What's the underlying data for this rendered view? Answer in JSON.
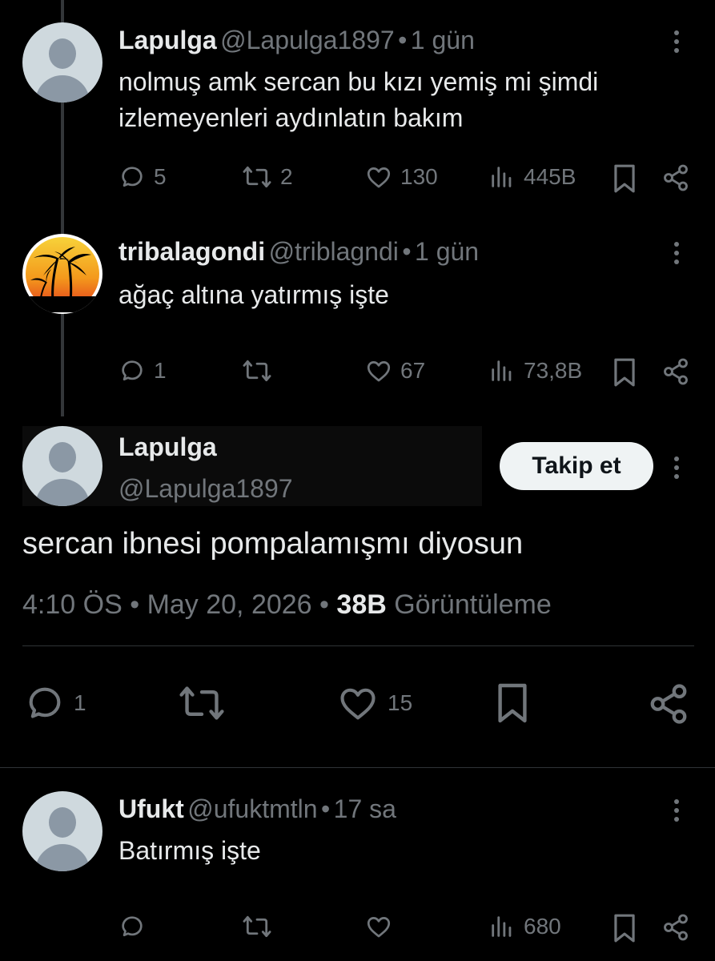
{
  "reply1": {
    "name": "Lapulga",
    "handle": "@Lapulga1897",
    "time": "1 gün",
    "text_line1": "nolmuş amk sercan bu kızı yemiş mi şimdi",
    "text_line2": "izlemeyenleri aydınlatın bakım",
    "replies": "5",
    "reposts": "2",
    "likes": "130",
    "views": "445B"
  },
  "reply2": {
    "name": "tribalagondi",
    "handle": "@triblagndi",
    "time": "1 gün",
    "text": "ağaç altına yatırmış işte",
    "replies": "1",
    "likes": "67",
    "views": "73,8B"
  },
  "main": {
    "name": "Lapulga",
    "handle": "@Lapulga1897",
    "follow_label": "Takip et",
    "text": "sercan ibnesi pompalamışmı diyosun",
    "time": "4:10 ÖS",
    "date": "May 20, 2026",
    "views_count": "38B",
    "views_label": "Görüntüleme",
    "replies": "1",
    "likes": "15"
  },
  "reply3": {
    "name": "Ufukt",
    "handle": "@ufuktmtln",
    "time": "17 sa",
    "text": "Batırmış işte",
    "views": "680"
  },
  "separator": "•",
  "colors": {
    "background": "#000000",
    "text": "#e7e9ea",
    "muted": "#71767b",
    "button": "#eff3f4"
  }
}
